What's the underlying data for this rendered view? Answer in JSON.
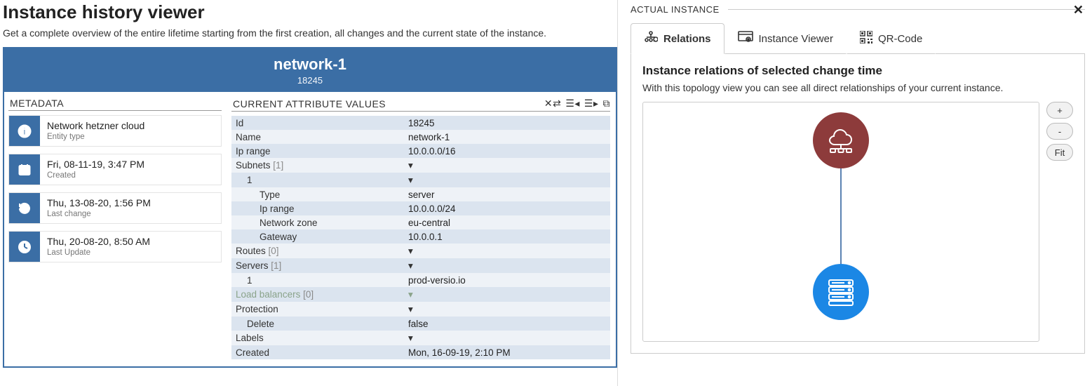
{
  "left": {
    "title": "Instance history viewer",
    "subtitle": "Get a complete overview of the entire lifetime starting from the first creation, all changes and the current state of the instance.",
    "header": {
      "name": "network-1",
      "id": "18245"
    },
    "metadata": {
      "section": "METADATA",
      "items": [
        {
          "icon": "info",
          "value": "Network hetzner cloud",
          "label": "Entity type"
        },
        {
          "icon": "calendar",
          "value": "Fri, 08-11-19, 3:47 PM",
          "label": "Created"
        },
        {
          "icon": "history",
          "value": "Thu, 13-08-20, 1:56 PM",
          "label": "Last change"
        },
        {
          "icon": "clock",
          "value": "Thu, 20-08-20, 8:50 AM",
          "label": "Last Update"
        }
      ]
    },
    "attributes": {
      "section": "CURRENT ATTRIBUTE VALUES",
      "tools": [
        "shuffle",
        "indent-left",
        "indent-right",
        "open-external"
      ],
      "rows": [
        {
          "k": "Id",
          "v": "18245",
          "indent": 0,
          "zebra": "even"
        },
        {
          "k": "Name",
          "v": "network-1",
          "indent": 0,
          "zebra": "odd"
        },
        {
          "k": "Ip range",
          "v": "10.0.0.0/16",
          "indent": 0,
          "zebra": "even"
        },
        {
          "k": "Subnets",
          "cnt": "[1]",
          "v": "▾",
          "indent": 0,
          "zebra": "odd",
          "caret": true
        },
        {
          "k": "1",
          "v": "▾",
          "indent": 1,
          "zebra": "even",
          "caret": true
        },
        {
          "k": "Type",
          "v": "server",
          "indent": 2,
          "zebra": "odd"
        },
        {
          "k": "Ip range",
          "v": "10.0.0.0/24",
          "indent": 2,
          "zebra": "even"
        },
        {
          "k": "Network zone",
          "v": "eu-central",
          "indent": 2,
          "zebra": "odd"
        },
        {
          "k": "Gateway",
          "v": "10.0.0.1",
          "indent": 2,
          "zebra": "even"
        },
        {
          "k": "Routes",
          "cnt": "[0]",
          "v": "▾",
          "indent": 0,
          "zebra": "odd",
          "caret": true
        },
        {
          "k": "Servers",
          "cnt": "[1]",
          "v": "▾",
          "indent": 0,
          "zebra": "even",
          "caret": true
        },
        {
          "k": "1",
          "v": "prod-versio.io",
          "indent": 1,
          "zebra": "odd"
        },
        {
          "k": "Load balancers",
          "cnt": "[0]",
          "v": "▾",
          "indent": 0,
          "zebra": "even",
          "caret": true,
          "muted": true
        },
        {
          "k": "Protection",
          "v": "▾",
          "indent": 0,
          "zebra": "odd",
          "caret": true
        },
        {
          "k": "Delete",
          "v": "false",
          "indent": 1,
          "zebra": "even"
        },
        {
          "k": "Labels",
          "v": "▾",
          "indent": 0,
          "zebra": "odd",
          "caret": true
        },
        {
          "k": "Created",
          "v": "Mon, 16-09-19, 2:10 PM",
          "indent": 0,
          "zebra": "even"
        }
      ]
    }
  },
  "right": {
    "panel_title": "ACTUAL INSTANCE",
    "tabs": [
      {
        "id": "relations",
        "label": "Relations",
        "icon": "relations",
        "active": true
      },
      {
        "id": "viewer",
        "label": "Instance Viewer",
        "icon": "instance-viewer",
        "active": false
      },
      {
        "id": "qr",
        "label": "QR-Code",
        "icon": "qr",
        "active": false
      }
    ],
    "pane": {
      "heading": "Instance relations of selected change time",
      "desc": "With this topology view you can see all direct relationships of your current instance."
    },
    "zoom": {
      "in": "+",
      "out": "-",
      "fit": "Fit"
    },
    "topology": {
      "nodes": [
        {
          "id": "cloud",
          "type": "network-cloud"
        },
        {
          "id": "server",
          "type": "server"
        }
      ],
      "edges": [
        {
          "from": "cloud",
          "to": "server"
        }
      ]
    }
  }
}
